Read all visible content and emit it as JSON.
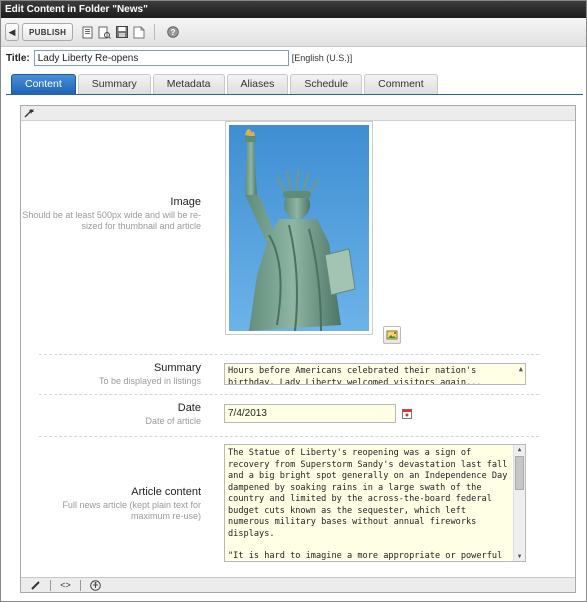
{
  "window": {
    "title": "Edit Content in Folder \"News\""
  },
  "toolbar": {
    "back_icon": "back-arrow-icon",
    "publish_label": "PUBLISH",
    "icons": [
      "checkin-icon",
      "preview-icon",
      "save-icon",
      "view-icon",
      "help-icon"
    ]
  },
  "title_field": {
    "label": "Title:",
    "value": "Lady Liberty Re-opens",
    "language": "[English (U.S.)]"
  },
  "tabs": [
    {
      "label": "Content",
      "active": true
    },
    {
      "label": "Summary",
      "active": false
    },
    {
      "label": "Metadata",
      "active": false
    },
    {
      "label": "Aliases",
      "active": false
    },
    {
      "label": "Schedule",
      "active": false
    },
    {
      "label": "Comment",
      "active": false
    }
  ],
  "fields": {
    "image": {
      "label": "Image",
      "hint": "Should be at least 500px wide and will be re-sized for thumbnail and article"
    },
    "summary": {
      "label": "Summary",
      "hint": "To be displayed in listings",
      "value": "Hours before Americans celebrated their nation's birthday, Lady Liberty welcomed visitors again..."
    },
    "date": {
      "label": "Date",
      "hint": "Date of article",
      "value": "7/4/2013"
    },
    "article": {
      "label": "Article content",
      "hint": "Full news article (kept plain text for maximum re-use)",
      "paragraph1": "The Statue of Liberty's reopening was a sign of recovery from Superstorm Sandy's devastation last fall and a big bright spot generally on an Independence Day dampened by soaking rains in a large swath of the country and limited by the across-the-board federal budget cuts known as the sequester, which left numerous military bases without annual fireworks displays.",
      "paragraph2": "\"It is hard to imagine a more appropriate or powerful"
    }
  },
  "editor_bottom_icons": [
    "pencil-icon",
    "code-icon",
    "accessibility-icon"
  ],
  "colors": {
    "accent": "#1e63b4",
    "field_bg": "#ffffe6",
    "sky": "#4a9ad8"
  }
}
